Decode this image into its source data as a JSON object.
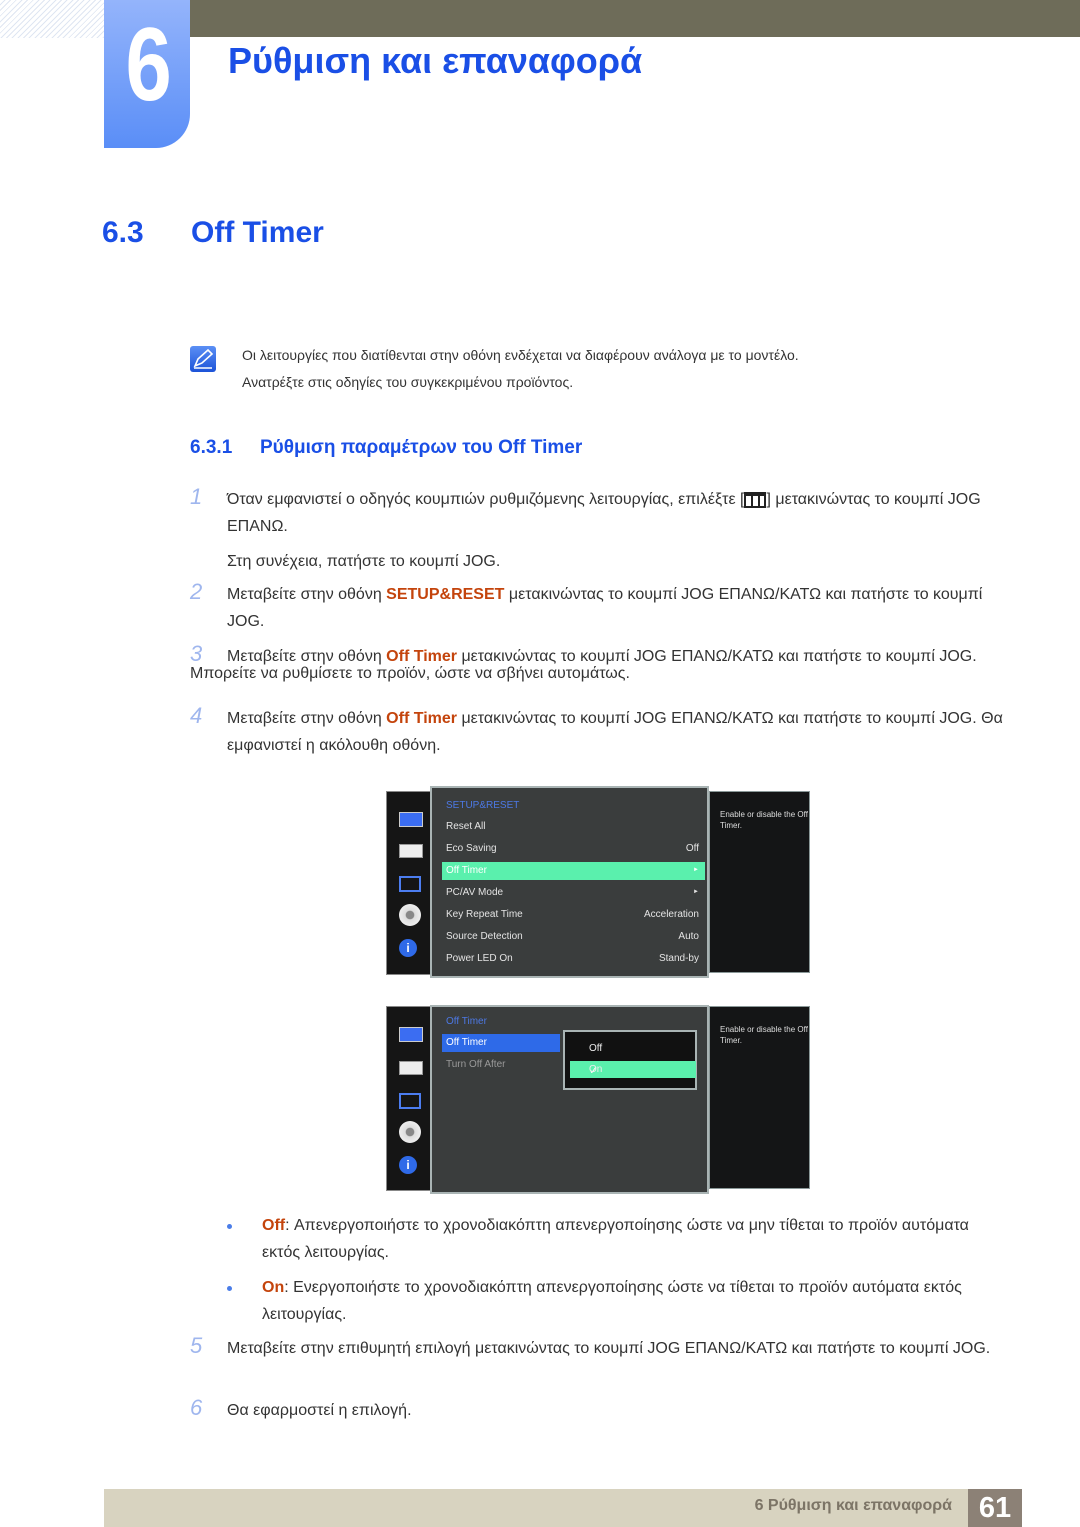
{
  "chapter": {
    "number": "6",
    "title": "Ρύθμιση και επαναφορά"
  },
  "section": {
    "number": "6.3",
    "title": "Off Timer"
  },
  "intro": "Μπορείτε να ρυθμίσετε το προϊόν, ώστε να σβήνει αυτομάτως.",
  "note": {
    "icon": "note-pencil-icon",
    "line1": "Οι λειτουργίες που διατίθενται στην οθόνη ενδέχεται να διαφέρουν ανάλογα με το μοντέλο.",
    "line2": "Ανατρέξτε στις οδηγίες του συγκεκριμένου προϊόντος."
  },
  "subsection": {
    "number": "6.3.1",
    "title": "Ρύθμιση παραμέτρων του Off Timer"
  },
  "steps": [
    {
      "n": "1",
      "pre": "Όταν εμφανιστεί ο οδηγός κουμπιών ρυθμιζόμενης λειτουργίας, επιλέξτε [",
      "icon": "menu-grid-icon",
      "post": "] μετακινώντας το κουμπί JOG ΕΠΑΝΩ.",
      "extra": "Στη συνέχεια, πατήστε το κουμπί JOG."
    },
    {
      "n": "2",
      "pre": "Μεταβείτε στην οθόνη ",
      "hl": "SETUP&RESET",
      "post": " μετακινώντας το κουμπί JOG ΕΠΑΝΩ/ΚΑΤΩ και πατήστε το κουμπί JOG."
    },
    {
      "n": "3",
      "pre": "Μεταβείτε στην οθόνη ",
      "hl": "Off Timer",
      "post": " μετακινώντας το κουμπί JOG ΕΠΑΝΩ/ΚΑΤΩ και πατήστε το κουμπί JOG."
    },
    {
      "n": "4",
      "pre": "Μεταβείτε στην οθόνη ",
      "hl": "Off Timer",
      "post": " μετακινώντας το κουμπί JOG ΕΠΑΝΩ/ΚΑΤΩ και πατήστε το κουμπί JOG. Θα εμφανιστεί η ακόλουθη οθόνη."
    },
    {
      "n": "5",
      "text": "Μεταβείτε στην επιθυμητή επιλογή μετακινώντας το κουμπί JOG ΕΠΑΝΩ/ΚΑΤΩ και πατήστε το κουμπί JOG."
    },
    {
      "n": "6",
      "text": "Θα εφαρμοστεί η επιλογή."
    }
  ],
  "osd1": {
    "title": "SETUP&RESET",
    "help": "Enable or disable the Off Timer.",
    "rows": [
      {
        "label": "Reset All",
        "value": ""
      },
      {
        "label": "Eco Saving",
        "value": "Off"
      },
      {
        "label": "Off Timer",
        "value": "►",
        "selected": true
      },
      {
        "label": "PC/AV Mode",
        "value": "►"
      },
      {
        "label": "Key Repeat Time",
        "value": "Acceleration"
      },
      {
        "label": "Source Detection",
        "value": "Auto"
      },
      {
        "label": "Power LED On",
        "value": "Stand-by"
      }
    ],
    "side_icons": [
      "monitor-icon",
      "picture-settings-icon",
      "position-arrows-icon",
      "gear-icon",
      "info-icon"
    ]
  },
  "osd2": {
    "title": "Off Timer",
    "help": "Enable or disable the Off Timer.",
    "rows": [
      {
        "label": "Off Timer"
      },
      {
        "label": "Turn Off After"
      }
    ],
    "options": [
      {
        "label": "Off"
      },
      {
        "label": "On",
        "checked": true
      }
    ]
  },
  "bullets": [
    {
      "key": "Off",
      "text": ": Απενεργοποιήστε το χρονοδιακόπτη απενεργοποίησης ώστε να μην τίθεται το προϊόν αυτόματα εκτός λειτουργίας."
    },
    {
      "key": "On",
      "text": ": Ενεργοποιήστε το χρονοδιακόπτη απενεργοποίησης ώστε να τίθεται το προϊόν αυτόματα εκτός λειτουργίας."
    }
  ],
  "footer": {
    "text": "6 Ρύθμιση και επαναφορά",
    "page": "61"
  }
}
